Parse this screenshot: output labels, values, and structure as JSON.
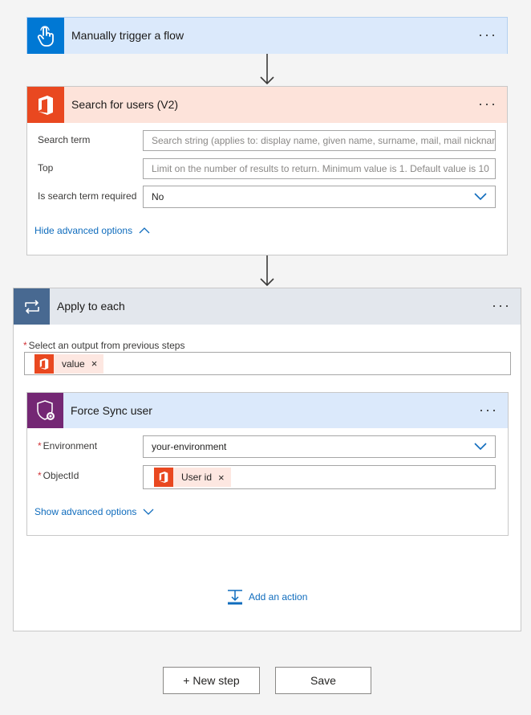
{
  "trigger": {
    "title": "Manually trigger a flow",
    "more_label": "···",
    "icon": "hand-touch-icon",
    "color": "#0078d4"
  },
  "search_users": {
    "title": "Search for users (V2)",
    "more_label": "···",
    "icon": "office-icon",
    "color": "#e94820",
    "fields": {
      "search_term": {
        "label": "Search term",
        "placeholder": "Search string (applies to: display name, given name, surname, mail, mail nicknam"
      },
      "top": {
        "label": "Top",
        "placeholder": "Limit on the number of results to return. Minimum value is 1. Default value is 10"
      },
      "required": {
        "label": "Is search term required",
        "value": "No"
      }
    },
    "advanced_link": "Hide advanced options"
  },
  "apply_each": {
    "title": "Apply to each",
    "more_label": "···",
    "icon": "loop-icon",
    "color": "#486991",
    "select_label": "Select an output from previous steps",
    "required_mark": "*",
    "token": {
      "label": "value",
      "remove": "×"
    }
  },
  "force_sync": {
    "title": "Force Sync user",
    "more_label": "···",
    "icon": "shield-gear-icon",
    "color": "#742774",
    "fields": {
      "environment": {
        "label": "Environment",
        "value": "your-environment",
        "required_mark": "*"
      },
      "object_id": {
        "label": "ObjectId",
        "required_mark": "*",
        "token": {
          "label": "User id",
          "remove": "×"
        }
      }
    },
    "advanced_link": "Show advanced options"
  },
  "add_action": {
    "label": "Add an action"
  },
  "footer": {
    "new_step": "+ New step",
    "save": "Save"
  }
}
